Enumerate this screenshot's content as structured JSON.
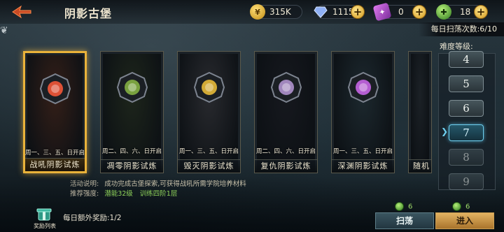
{
  "header": {
    "title": "阴影古堡",
    "resources": [
      {
        "name": "gold",
        "value": "315K",
        "icon": "coin-icon",
        "color": "#e7b838"
      },
      {
        "name": "diamond",
        "value": "1115",
        "icon": "diamond-icon",
        "color": "#7e9be8"
      },
      {
        "name": "ticket",
        "value": "0",
        "icon": "ticket-icon",
        "color": "#c052e0"
      },
      {
        "name": "stamina",
        "value": "18",
        "icon": "stamina-icon",
        "color": "#6cc23c"
      }
    ],
    "daily_sweeps": "每日扫荡次数:6/10"
  },
  "cards": [
    {
      "name": "战吼阴影试炼",
      "schedule": "周一、三、五、日开启",
      "emblem_color": "#ff5a3a",
      "bg": "#3a1e14",
      "selected": true
    },
    {
      "name": "凋零阴影试炼",
      "schedule": "周二、四、六、日开启",
      "emblem_color": "#8ab844",
      "bg": "#1e2618",
      "selected": false
    },
    {
      "name": "毁灭阴影试炼",
      "schedule": "周一、三、五、日开启",
      "emblem_color": "#f2c33a",
      "bg": "#2c2c30",
      "selected": false
    },
    {
      "name": "复仇阴影试炼",
      "schedule": "周二、四、六、日开启",
      "emblem_color": "#b89ad8",
      "bg": "#15161c",
      "selected": false
    },
    {
      "name": "深渊阴影试炼",
      "schedule": "周一、三、五、日开启",
      "emblem_color": "#d06af0",
      "bg": "#1d2a30",
      "selected": false
    },
    {
      "name": "随机",
      "schedule": "",
      "emblem_color": "#888888",
      "bg": "#1c2126",
      "selected": false
    }
  ],
  "difficulty": {
    "label": "难度等级:",
    "levels": [
      "4",
      "5",
      "6",
      "7",
      "8",
      "9"
    ],
    "selected": "7"
  },
  "info": {
    "desc_label": "活动说明:",
    "desc_text": "成功完成古堡探索,可获得战吼所需学院培养材料",
    "rec_label": "推荐强度:",
    "rec_power": "潜能32级",
    "rec_training": "训练四阶1层"
  },
  "footer": {
    "reward_list_label": "奖励列表",
    "daily_extra": "每日额外奖励:1/2",
    "sweep_cost": "6",
    "enter_cost": "6",
    "sweep_label": "扫荡",
    "enter_label": "进入"
  }
}
